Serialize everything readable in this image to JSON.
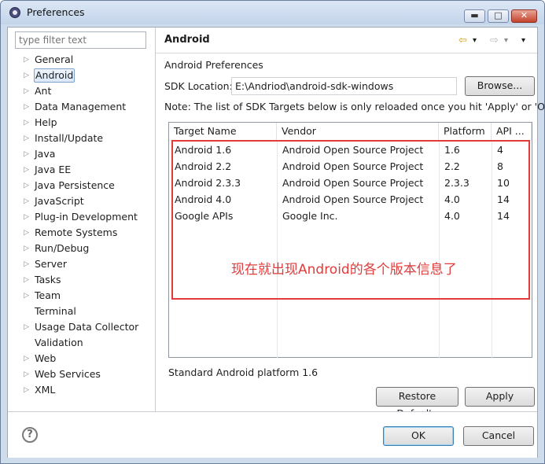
{
  "window": {
    "title": "Preferences"
  },
  "titlebar": {
    "min": "▬",
    "max": "□",
    "close": "✕"
  },
  "filter": {
    "placeholder": "type filter text"
  },
  "tree": [
    {
      "label": "General",
      "arrow": "▷"
    },
    {
      "label": "Android",
      "arrow": "▷",
      "selected": true
    },
    {
      "label": "Ant",
      "arrow": "▷"
    },
    {
      "label": "Data Management",
      "arrow": "▷"
    },
    {
      "label": "Help",
      "arrow": "▷"
    },
    {
      "label": "Install/Update",
      "arrow": "▷"
    },
    {
      "label": "Java",
      "arrow": "▷"
    },
    {
      "label": "Java EE",
      "arrow": "▷"
    },
    {
      "label": "Java Persistence",
      "arrow": "▷"
    },
    {
      "label": "JavaScript",
      "arrow": "▷"
    },
    {
      "label": "Plug-in Development",
      "arrow": "▷"
    },
    {
      "label": "Remote Systems",
      "arrow": "▷"
    },
    {
      "label": "Run/Debug",
      "arrow": "▷"
    },
    {
      "label": "Server",
      "arrow": "▷"
    },
    {
      "label": "Tasks",
      "arrow": "▷"
    },
    {
      "label": "Team",
      "arrow": "▷"
    },
    {
      "label": "Terminal",
      "arrow": ""
    },
    {
      "label": "Usage Data Collector",
      "arrow": "▷"
    },
    {
      "label": "Validation",
      "arrow": ""
    },
    {
      "label": "Web",
      "arrow": "▷"
    },
    {
      "label": "Web Services",
      "arrow": "▷"
    },
    {
      "label": "XML",
      "arrow": "▷"
    }
  ],
  "page": {
    "title": "Android",
    "nav": {
      "back": "⇦",
      "fwd": "⇨",
      "drop": "▾",
      "menu": "▾"
    },
    "prefs_label": "Android Preferences",
    "sdk_label": "SDK Location:",
    "sdk_value": "E:\\Andriod\\android-sdk-windows",
    "browse": "Browse...",
    "note": "Note: The list of SDK Targets below is only reloaded once you hit 'Apply' or 'OK'.",
    "status": "Standard Android platform 1.6",
    "restore": "Restore Defaults",
    "apply": "Apply",
    "annotation": "现在就出现Android的各个版本信息了"
  },
  "table": {
    "headers": [
      "Target Name",
      "Vendor",
      "Platform",
      "API ..."
    ],
    "rows": [
      {
        "name": "Android 1.6",
        "vendor": "Android Open Source Project",
        "platform": "1.6",
        "api": "4"
      },
      {
        "name": "Android 2.2",
        "vendor": "Android Open Source Project",
        "platform": "2.2",
        "api": "8"
      },
      {
        "name": "Android 2.3.3",
        "vendor": "Android Open Source Project",
        "platform": "2.3.3",
        "api": "10"
      },
      {
        "name": "Android 4.0",
        "vendor": "Android Open Source Project",
        "platform": "4.0",
        "api": "14"
      },
      {
        "name": "Google APIs",
        "vendor": "Google Inc.",
        "platform": "4.0",
        "api": "14"
      }
    ]
  },
  "footer": {
    "help": "?",
    "ok": "OK",
    "cancel": "Cancel"
  },
  "colors": {
    "annotation": "#e23b3b",
    "titlebar": "#c3d4ea",
    "close": "#c4432c"
  }
}
